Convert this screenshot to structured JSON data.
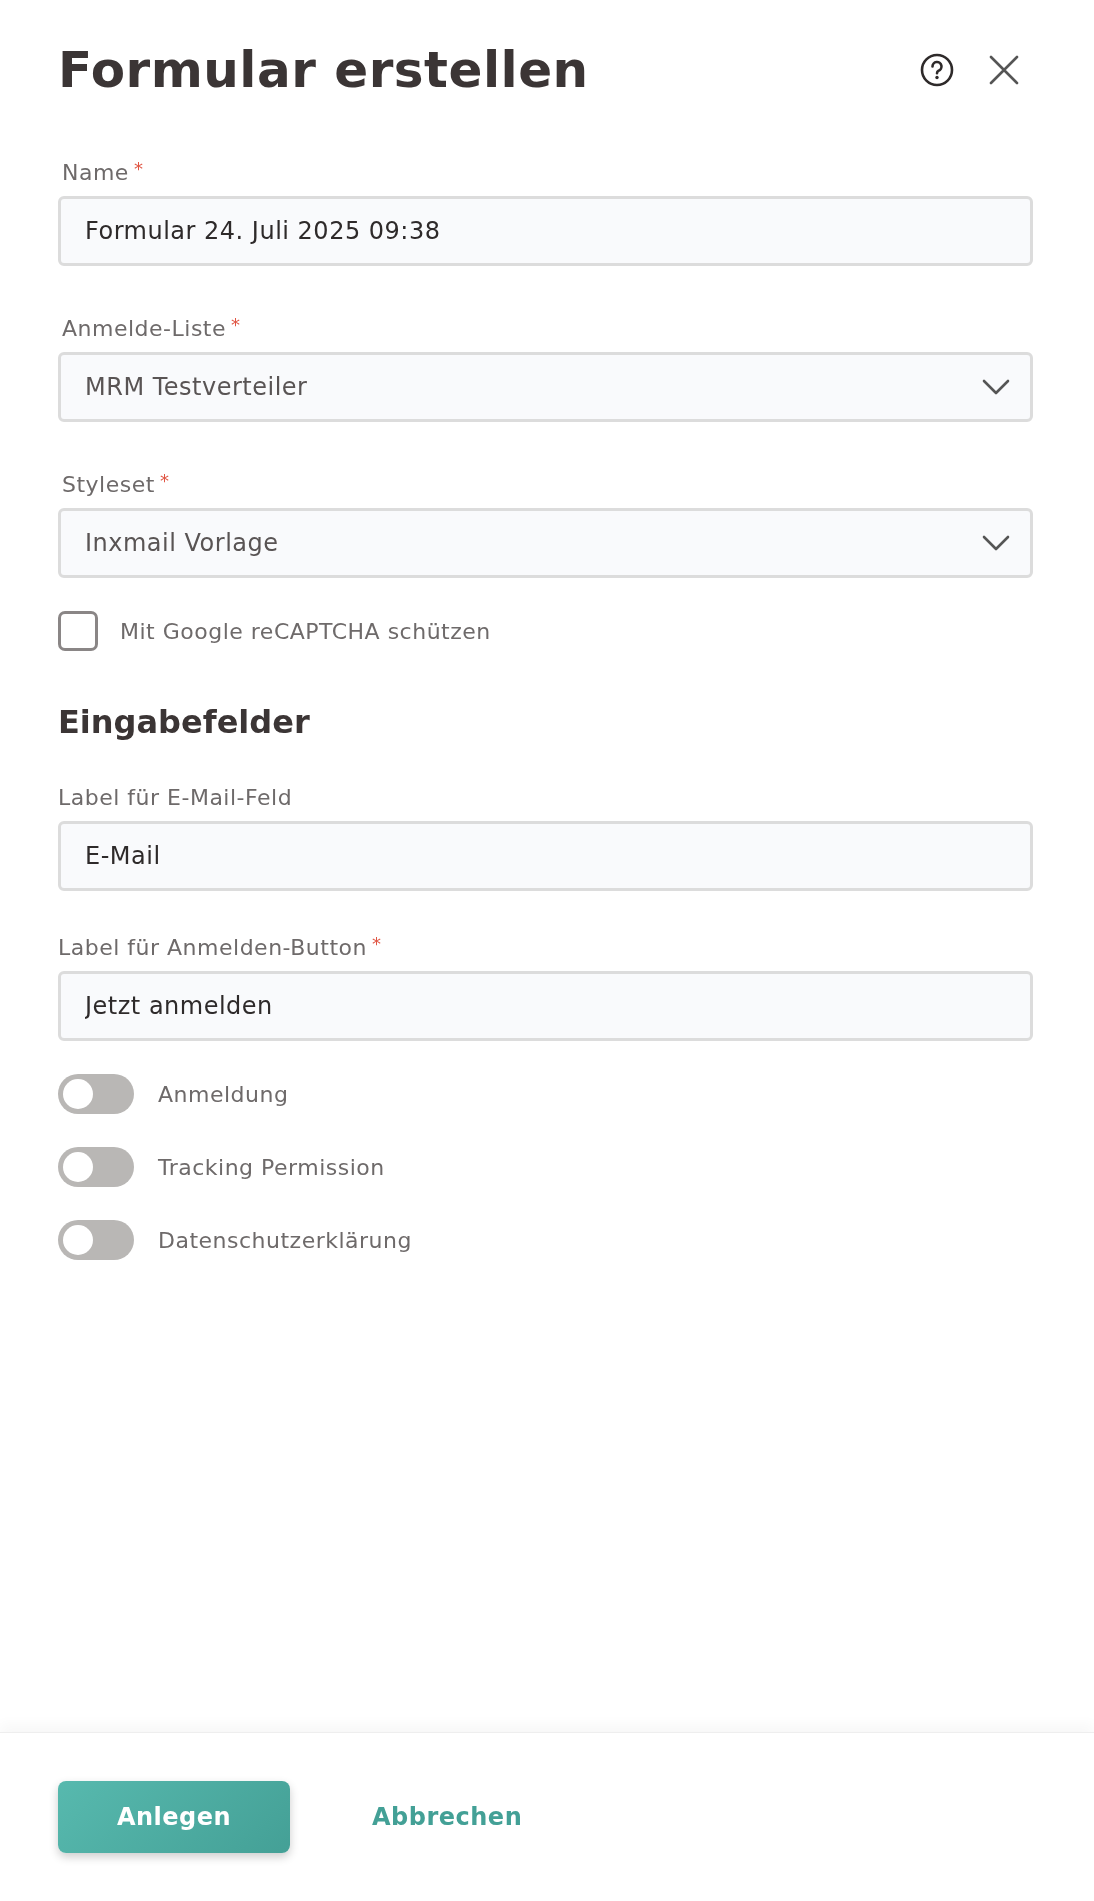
{
  "dialog": {
    "title": "Formular erstellen"
  },
  "fields": [
    {
      "kind": "text",
      "label": "Name",
      "required_mark": "*",
      "value": "Formular 24. Juli 2025 09:38"
    },
    {
      "kind": "select",
      "label": "Anmelde-Liste",
      "required_mark": "*",
      "value": "MRM Testverteiler"
    },
    {
      "kind": "select",
      "label": "Styleset",
      "required_mark": "*",
      "value": "Inxmail Vorlage"
    }
  ],
  "recaptcha": {
    "label": "Mit Google reCAPTCHA schützen",
    "checked": false
  },
  "section": {
    "title": "Eingabefelder",
    "fields": [
      {
        "kind": "text",
        "label": "Label für E-Mail-Feld",
        "value": "E-Mail"
      },
      {
        "kind": "text",
        "label": "Label für Anmelden-Button",
        "required_mark": "*",
        "value": "Jetzt anmelden"
      }
    ],
    "toggles": [
      {
        "label": "Anmeldung",
        "on": false
      },
      {
        "label": "Tracking Permission",
        "on": false
      },
      {
        "label": "Datenschutzerklärung",
        "on": false
      }
    ]
  },
  "buttons": {
    "primary": "Anlegen",
    "secondary": "Abbrechen"
  }
}
